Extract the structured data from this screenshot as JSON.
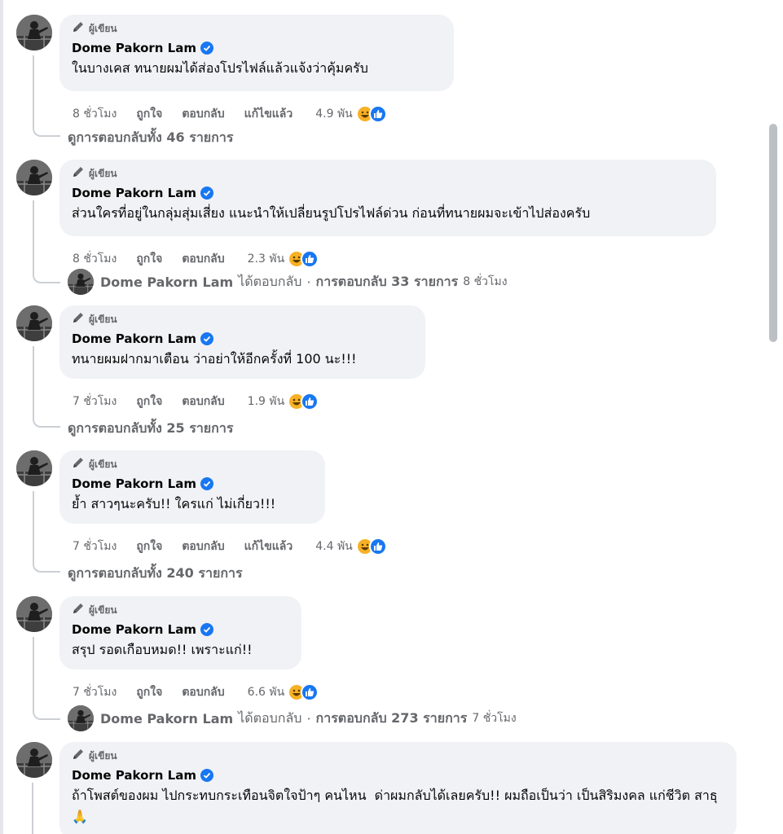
{
  "comments": [
    {
      "badge": "ผู้เขียน",
      "name": "Dome Pakorn Lam",
      "text": "ในบางเคส ทนายผมได้ส่องโปรไฟล์แล้วแจ้งว่าคุ้มครับ",
      "time": "8 ชั่วโมง",
      "like": "ถูกใจ",
      "reply": "ตอบกลับ",
      "edited": "แก้ไขแล้ว",
      "count": "4.9 พัน",
      "footer": {
        "type": "view",
        "label": "ดูการตอบกลับทั้ง 46 รายการ"
      }
    },
    {
      "badge": "ผู้เขียน",
      "name": "Dome Pakorn Lam",
      "text": "ส่วนใครที่อยู่ในกลุ่มสุ่มเสี่ยง แนะนำให้เปลี่ยนรูปโปรไฟล์ด่วน ก่อนที่ทนายผมจะเข้าไปส่องครับ",
      "time": "8 ชั่วโมง",
      "like": "ถูกใจ",
      "reply": "ตอบกลับ",
      "edited": "",
      "count": "2.3 พัน",
      "footer": {
        "type": "replied",
        "name": "Dome Pakorn Lam",
        "replied": "ได้ตอบกลับ",
        "dot": "·",
        "count_label": "การตอบกลับ 33 รายการ",
        "time": "8 ชั่วโมง"
      }
    },
    {
      "badge": "ผู้เขียน",
      "name": "Dome Pakorn Lam",
      "text": "ทนายผมฝากมาเตือน ว่าอย่าให้อีกครั้งที่ 100 นะ!!!",
      "time": "7 ชั่วโมง",
      "like": "ถูกใจ",
      "reply": "ตอบกลับ",
      "edited": "",
      "count": "1.9 พัน",
      "footer": {
        "type": "view",
        "label": "ดูการตอบกลับทั้ง 25 รายการ"
      }
    },
    {
      "badge": "ผู้เขียน",
      "name": "Dome Pakorn Lam",
      "text": "ย้ำ สาวๆนะครับ!! ใครแก่ ไม่เกี่ยว!!!",
      "time": "7 ชั่วโมง",
      "like": "ถูกใจ",
      "reply": "ตอบกลับ",
      "edited": "แก้ไขแล้ว",
      "count": "4.4 พัน",
      "footer": {
        "type": "view",
        "label": "ดูการตอบกลับทั้ง 240 รายการ"
      }
    },
    {
      "badge": "ผู้เขียน",
      "name": "Dome Pakorn Lam",
      "text": "สรุป รอดเกือบหมด!! เพราะแก่!!",
      "time": "7 ชั่วโมง",
      "like": "ถูกใจ",
      "reply": "ตอบกลับ",
      "edited": "",
      "count": "6.6 พัน",
      "footer": {
        "type": "replied",
        "name": "Dome Pakorn Lam",
        "replied": "ได้ตอบกลับ",
        "dot": "·",
        "count_label": "การตอบกลับ 273 รายการ",
        "time": "7 ชั่วโมง"
      }
    },
    {
      "badge": "ผู้เขียน",
      "name": "Dome Pakorn Lam",
      "text": "ถ้าโพสต์ของผม ไปกระทบกระเทือนจิตใจป้าๆ คนไหน  ด่าผมกลับได้เลยครับ!! ผมถือเป็นว่า เป็นสิริมงคล แก่ชีวิต สาธุ🙏",
      "time": "",
      "like": "",
      "reply": "",
      "edited": "",
      "count": "",
      "footer": {
        "type": "none"
      }
    }
  ],
  "icons": {
    "badge": "pencil-icon",
    "verified": "verified-check-icon",
    "haha": "haha-reaction-icon",
    "like": "like-reaction-icon"
  },
  "colors": {
    "bubble": "#f0f2f5",
    "verified": "#1877f2",
    "haha": "#f7b125",
    "muted": "#65676b"
  }
}
